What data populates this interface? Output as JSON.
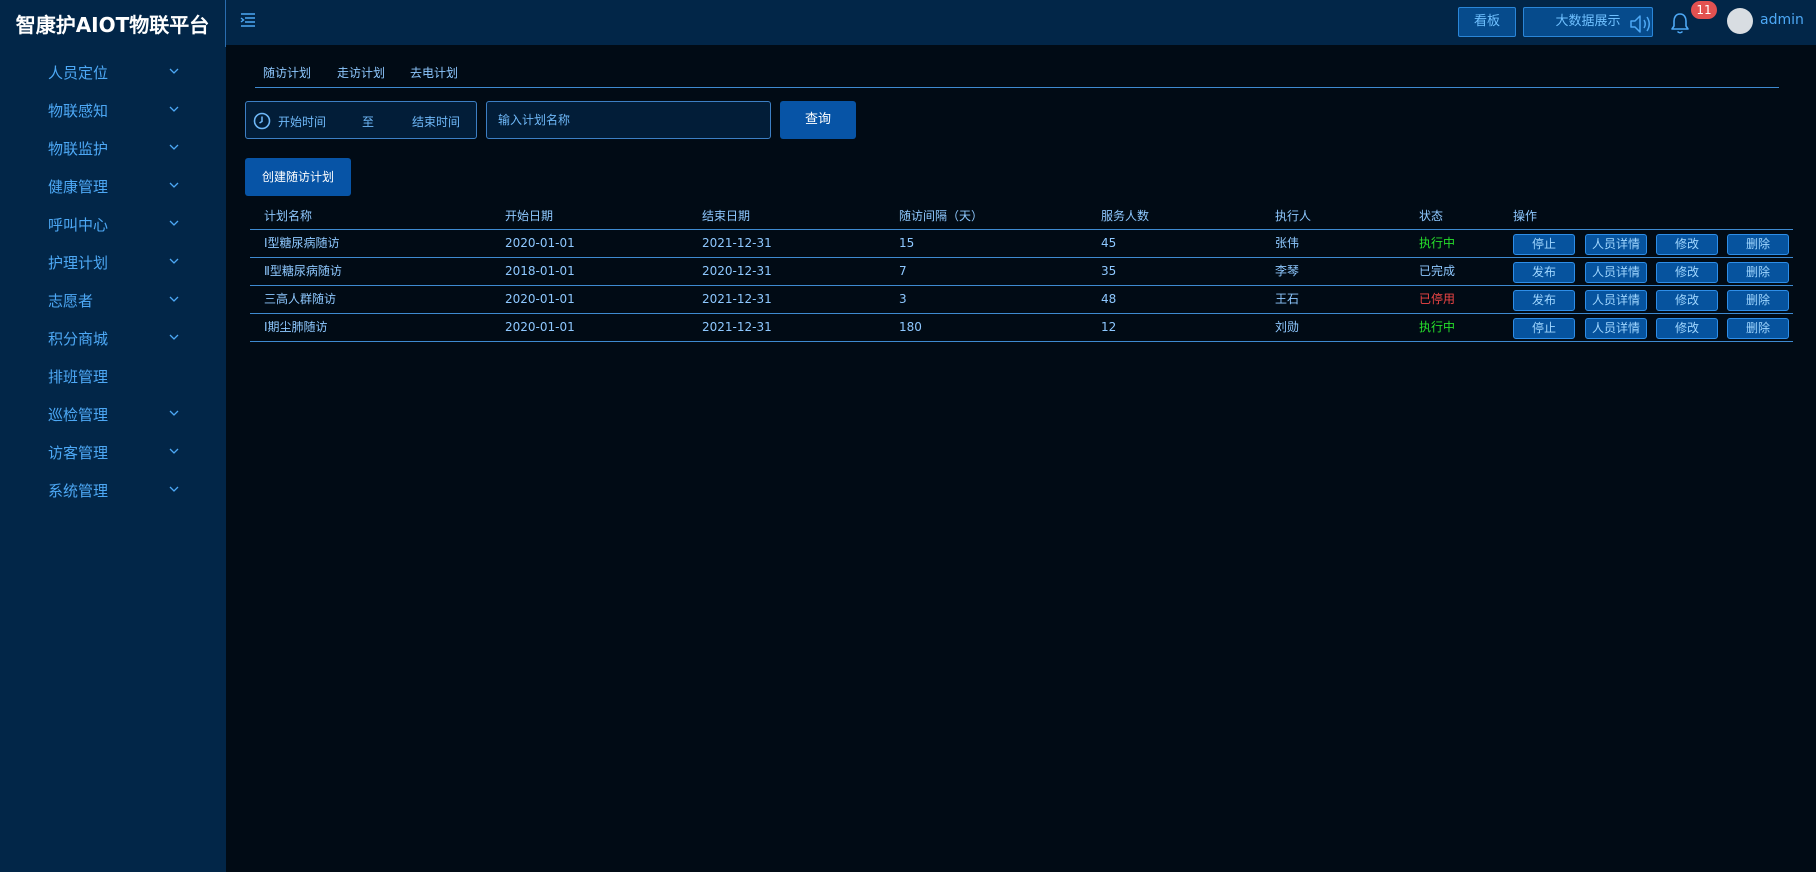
{
  "app": {
    "title": "智康护AIOT物联平台"
  },
  "sidebar": {
    "items": [
      {
        "label": "人员定位",
        "expandable": true
      },
      {
        "label": "物联感知",
        "expandable": true
      },
      {
        "label": "物联监护",
        "expandable": true
      },
      {
        "label": "健康管理",
        "expandable": true
      },
      {
        "label": "呼叫中心",
        "expandable": true
      },
      {
        "label": "护理计划",
        "expandable": true
      },
      {
        "label": "志愿者",
        "expandable": true
      },
      {
        "label": "积分商城",
        "expandable": true
      },
      {
        "label": "排班管理",
        "expandable": false
      },
      {
        "label": "巡检管理",
        "expandable": true
      },
      {
        "label": "访客管理",
        "expandable": true
      },
      {
        "label": "系统管理",
        "expandable": true
      }
    ]
  },
  "header": {
    "kanban_label": "看板",
    "bigdata_label": "大数据展示",
    "notification_count": "11",
    "username": "admin",
    "icons": [
      "menu-toggle-icon",
      "speaker-icon",
      "bell-icon"
    ]
  },
  "tabs": [
    {
      "label": "随访计划"
    },
    {
      "label": "走访计划"
    },
    {
      "label": "去电计划"
    }
  ],
  "filters": {
    "start_placeholder": "开始时间",
    "separator": "至",
    "end_placeholder": "结束时间",
    "name_placeholder": "输入计划名称",
    "query_label": "查询"
  },
  "create_label": "创建随访计划",
  "table": {
    "columns": [
      "计划名称",
      "开始日期",
      "结束日期",
      "随访间隔（天）",
      "服务人数",
      "执行人",
      "状态",
      "操作"
    ],
    "rows": [
      {
        "name": "Ⅰ型糖尿病随访",
        "start": "2020-01-01",
        "end": "2021-12-31",
        "interval": "15",
        "count": "45",
        "executor": "张伟",
        "status": "执行中",
        "status_type": "running",
        "actions": [
          "停止",
          "人员详情",
          "修改",
          "删除"
        ]
      },
      {
        "name": "Ⅱ型糖尿病随访",
        "start": "2018-01-01",
        "end": "2020-12-31",
        "interval": "7",
        "count": "35",
        "executor": "李琴",
        "status": "已完成",
        "status_type": "done",
        "actions": [
          "发布",
          "人员详情",
          "修改",
          "删除"
        ]
      },
      {
        "name": "三高人群随访",
        "start": "2020-01-01",
        "end": "2021-12-31",
        "interval": "3",
        "count": "48",
        "executor": "王石",
        "status": "已停用",
        "status_type": "stopped",
        "actions": [
          "发布",
          "人员详情",
          "修改",
          "删除"
        ]
      },
      {
        "name": "Ⅰ期尘肺随访",
        "start": "2020-01-01",
        "end": "2021-12-31",
        "interval": "180",
        "count": "12",
        "executor": "刘勋",
        "status": "执行中",
        "status_type": "running",
        "actions": [
          "停止",
          "人员详情",
          "修改",
          "删除"
        ]
      }
    ]
  },
  "colors": {
    "sidebar_bg": "#022648",
    "page_bg": "#010b15",
    "accent": "#0754a6",
    "status_running": "#26e02b",
    "status_stopped": "#f04545",
    "badge": "#e25151"
  }
}
